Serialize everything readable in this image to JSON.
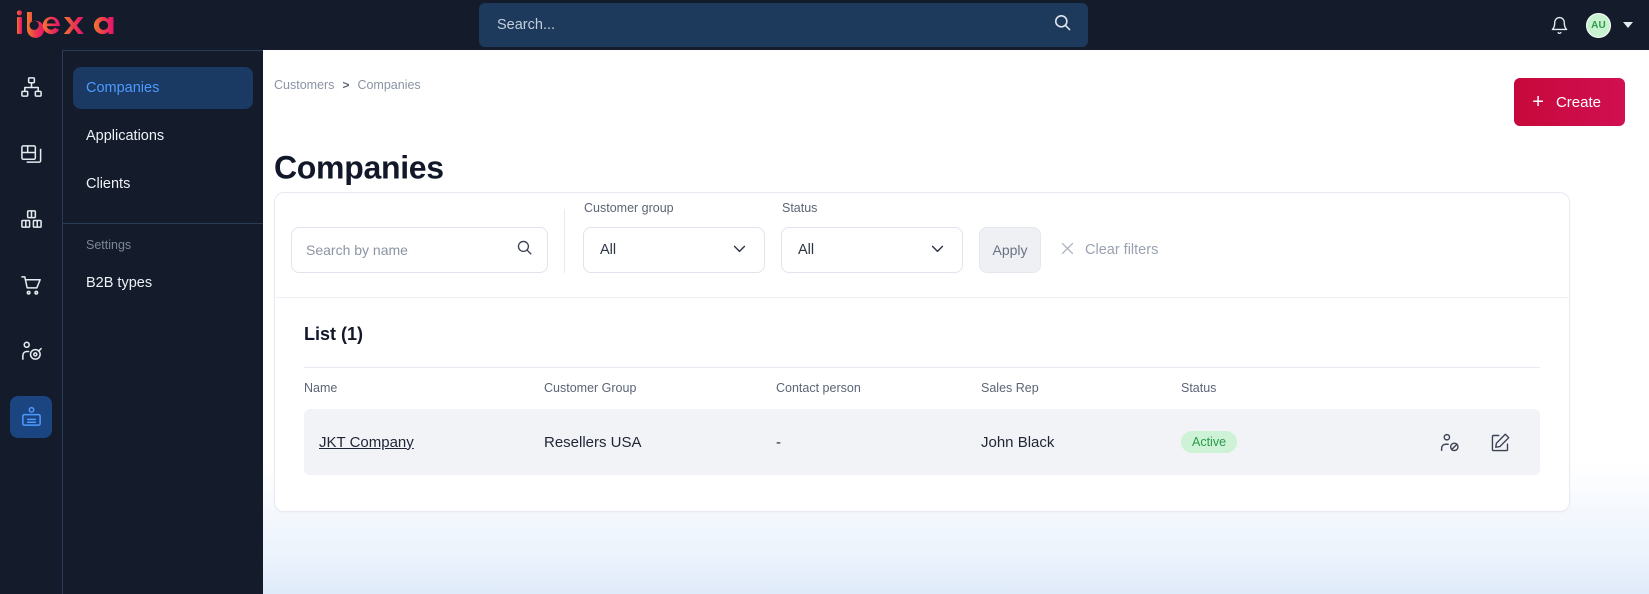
{
  "header": {
    "logo_text": "ibexa",
    "search": {
      "placeholder": "Search...",
      "value": "",
      "icon": "search-icon"
    },
    "notifications_icon": "bell-icon",
    "avatar_initials": "AU",
    "user_menu_icon": "chevron-down-icon"
  },
  "icon_rail": {
    "items": [
      {
        "name": "sitemap-icon",
        "active": false
      },
      {
        "name": "content-cards-icon",
        "active": false
      },
      {
        "name": "products-boxes-icon",
        "active": false
      },
      {
        "name": "shopping-cart-icon",
        "active": false
      },
      {
        "name": "marketing-target-icon",
        "active": false
      },
      {
        "name": "customers-badge-icon",
        "active": true
      }
    ]
  },
  "sidebar": {
    "items": [
      {
        "label": "Companies",
        "active": true
      },
      {
        "label": "Applications",
        "active": false
      },
      {
        "label": "Clients",
        "active": false
      }
    ],
    "section_label": "Settings",
    "settings_items": [
      {
        "label": "B2B types",
        "active": false
      }
    ]
  },
  "main": {
    "breadcrumb": {
      "parent": "Customers",
      "separator": ">",
      "current": "Companies"
    },
    "page_title": "Companies",
    "create_button": {
      "label": "Create",
      "icon": "plus-icon",
      "color": "#c6093b"
    }
  },
  "filters": {
    "search": {
      "placeholder": "Search by name",
      "value": "",
      "icon": "search-icon"
    },
    "customer_group": {
      "label": "Customer group",
      "value": "All",
      "icon": "chevron-down-icon"
    },
    "status": {
      "label": "Status",
      "value": "All",
      "icon": "chevron-down-icon"
    },
    "apply_label": "Apply",
    "clear_label": "Clear filters",
    "clear_icon": "close-x-icon"
  },
  "list": {
    "title": "List (1)",
    "columns": [
      "Name",
      "Customer Group",
      "Contact person",
      "Sales Rep",
      "Status"
    ],
    "rows": [
      {
        "name": "JKT Company",
        "customer_group": "Resellers USA",
        "contact_person": "-",
        "sales_rep": "John Black",
        "status": "Active",
        "status_color": "#2b9b4a",
        "actions": [
          "user-block-icon",
          "edit-pencil-icon"
        ]
      }
    ]
  }
}
